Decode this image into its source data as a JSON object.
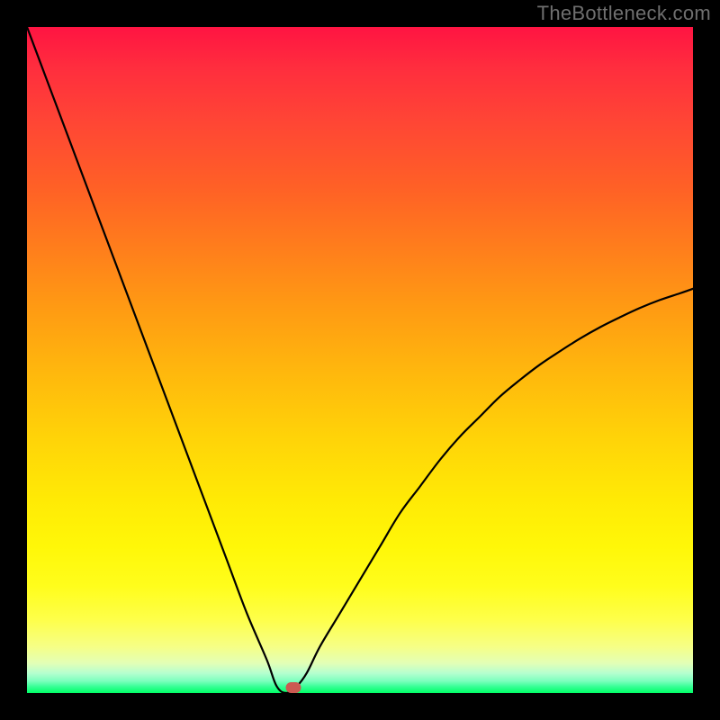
{
  "watermark": "TheBottleneck.com",
  "chart_data": {
    "type": "line",
    "title": "",
    "xlabel": "",
    "ylabel": "",
    "xlim": [
      0,
      100
    ],
    "ylim": [
      0,
      100
    ],
    "series": [
      {
        "name": "bottleneck-curve",
        "x": [
          0,
          3,
          6,
          9,
          12,
          15,
          18,
          21,
          24,
          27,
          30,
          33,
          36,
          37.5,
          39,
          40.5,
          42,
          44,
          47,
          50,
          53,
          56,
          59,
          62,
          65,
          68,
          71,
          74,
          77,
          80,
          83,
          86,
          89,
          92,
          95,
          98,
          100
        ],
        "values": [
          100,
          92,
          84,
          76,
          68,
          60,
          52,
          44,
          36,
          28,
          20,
          12,
          5,
          1,
          0,
          1,
          3,
          7,
          12,
          17,
          22,
          27,
          31,
          35,
          38.5,
          41.5,
          44.5,
          47,
          49.3,
          51.3,
          53.2,
          54.9,
          56.4,
          57.8,
          59,
          60,
          60.7
        ]
      }
    ],
    "marker": {
      "x": 40,
      "y": 0.8
    },
    "gradient_stops": [
      {
        "pos": 0,
        "color": "#ff1442"
      },
      {
        "pos": 0.33,
        "color": "#ff7d1c"
      },
      {
        "pos": 0.62,
        "color": "#ffd408"
      },
      {
        "pos": 0.84,
        "color": "#fffd1c"
      },
      {
        "pos": 0.97,
        "color": "#b6ffcf"
      },
      {
        "pos": 1.0,
        "color": "#00ff66"
      }
    ]
  }
}
